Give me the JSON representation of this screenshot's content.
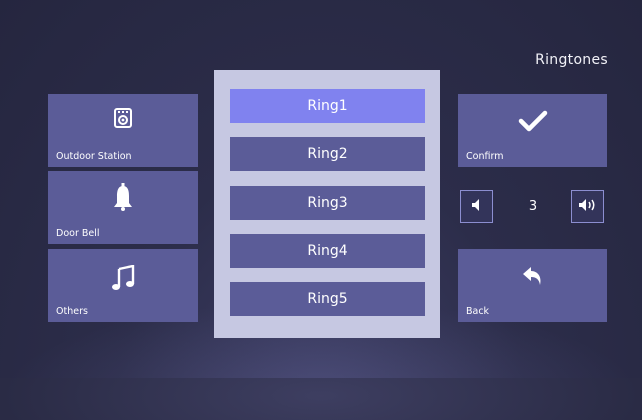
{
  "title": "Ringtones",
  "left_menu": [
    {
      "label": "Outdoor Station",
      "icon": "outdoor-station-icon"
    },
    {
      "label": "Door Bell",
      "icon": "bell-icon"
    },
    {
      "label": "Others",
      "icon": "music-note-icon"
    }
  ],
  "ringtones": [
    {
      "label": "Ring1",
      "selected": true
    },
    {
      "label": "Ring2",
      "selected": false
    },
    {
      "label": "Ring3",
      "selected": false
    },
    {
      "label": "Ring4",
      "selected": false
    },
    {
      "label": "Ring5",
      "selected": false
    }
  ],
  "confirm": {
    "label": "Confirm",
    "icon": "checkmark-icon"
  },
  "volume": {
    "level": "3",
    "down_icon": "volume-down-icon",
    "up_icon": "volume-up-icon"
  },
  "back": {
    "label": "Back",
    "icon": "back-arrow-icon"
  },
  "colors": {
    "tile": "#5b5c98",
    "selected_ring": "#8082ef",
    "panel": "#c6c8e2",
    "background": "#2a2b45"
  }
}
